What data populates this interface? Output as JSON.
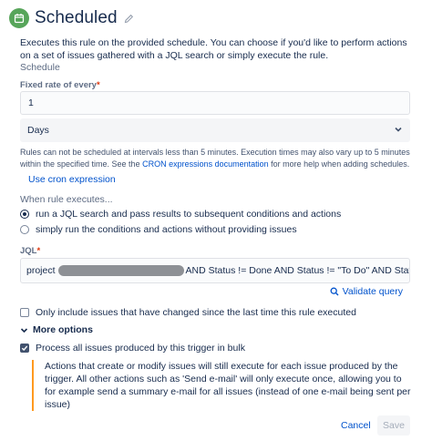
{
  "header": {
    "title": "Scheduled",
    "icon": "calendar-icon",
    "edit_icon": "pencil-icon",
    "accent": "#57a55a"
  },
  "description": "Executes this rule on the provided schedule. You can choose if you'd like to perform actions on a set of issues gathered with a JQL search or simply execute the rule.",
  "schedule": {
    "section_label": "Schedule",
    "rate_label": "Fixed rate of every",
    "rate_required": "*",
    "rate_value": "1",
    "unit_value": "Days",
    "help_text_1": "Rules can not be scheduled at intervals less than 5 minutes. Execution times may also vary up to 5 minutes within the specified time. See the ",
    "help_link": "CRON expressions documentation",
    "help_text_2": " for more help when adding schedules.",
    "cron_link": "Use cron expression"
  },
  "execution": {
    "label": "When rule executes...",
    "options": [
      {
        "label": "run a JQL search and pass results to subsequent conditions and actions",
        "selected": true
      },
      {
        "label": "simply run the conditions and actions without providing issues",
        "selected": false
      }
    ]
  },
  "jql": {
    "label": "JQL",
    "required": "*",
    "prefix": "project",
    "suffix": "AND Status != Done AND Status != \"To Do\" AND Status != Ba",
    "validate_label": "Validate query"
  },
  "changed_only": {
    "label": "Only include issues that have changed since the last time this rule executed",
    "checked": false
  },
  "more_options": {
    "label": "More options",
    "bulk_label": "Process all issues produced by this trigger in bulk",
    "bulk_checked": true,
    "note": "Actions that create or modify issues will still execute for each issue produced by the trigger. All other actions such as 'Send e-mail' will only execute once, allowing you to for example send a summary e-mail for all issues (instead of one e-mail being sent per issue)"
  },
  "footer": {
    "cancel_label": "Cancel",
    "save_label": "Save"
  }
}
